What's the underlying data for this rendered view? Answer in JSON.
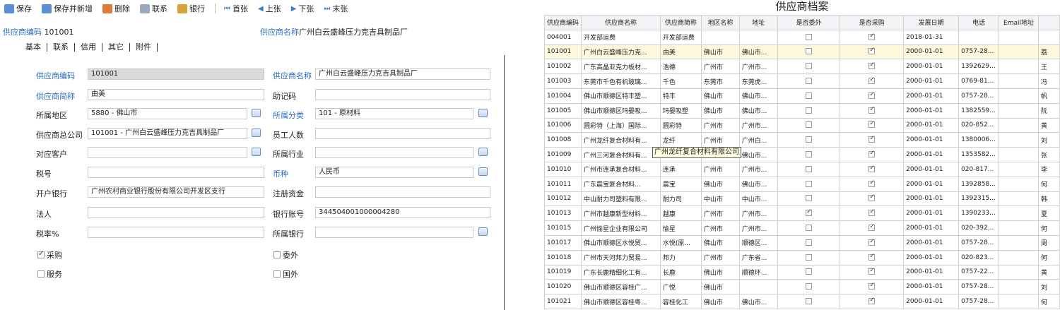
{
  "toolbar": {
    "save": "保存",
    "save_new": "保存并新增",
    "delete": "删除",
    "contact": "联系",
    "bank": "银行",
    "first": "首张",
    "prev": "上张",
    "next": "下张",
    "last": "末张"
  },
  "header": {
    "code_label": "供应商编码",
    "code_value": "101001",
    "name_label": "供应商名称",
    "name_value": "广州白云盛峰压力克吉具制品厂"
  },
  "tabs": [
    "基本",
    "联系",
    "信用",
    "其它",
    "附件"
  ],
  "form": {
    "code_label": "供应商编码",
    "code_value": "101001",
    "name_label": "供应商名称",
    "name_value": "广州白云盛峰压力克吉具制品厂",
    "abbr_label": "供应商简称",
    "abbr_value": "由美",
    "mnemonic_label": "助记码",
    "mnemonic_value": "",
    "region_label": "所属地区",
    "region_value": "5880 - 佛山市",
    "category_label": "所属分类",
    "category_value": "101 - 原材料",
    "hq_label": "供应商总公司",
    "hq_value": "101001 - 广州白云盛峰压力克吉具制品厂",
    "staff_label": "员工人数",
    "staff_value": "",
    "customer_label": "对应客户",
    "customer_value": "",
    "industry_label": "所属行业",
    "industry_value": "",
    "tax_label": "税号",
    "tax_value": "",
    "currency_label": "币种",
    "currency_value": "人民币",
    "bank_label": "开户银行",
    "bank_value": "广州农村商业银行股份有限公司开发区支行",
    "capital_label": "注册资金",
    "capital_value": "",
    "legal_label": "法人",
    "legal_value": "",
    "account_label": "银行账号",
    "account_value": "344504001000004280",
    "rate_label": "税率%",
    "rate_value": "",
    "bank2_label": "所属银行",
    "bank2_value": "",
    "purchase_label": "采购",
    "outsource_label": "委外",
    "service_label": "服务",
    "foreign_label": "国外"
  },
  "checks": {
    "purchase": true,
    "outsource": false,
    "service": false,
    "foreign": false
  },
  "list": {
    "title": "供应商档案",
    "columns": [
      "供应商编码",
      "供应商名称",
      "供应商简称",
      "地区名称",
      "地址",
      "是否委外",
      "是否采购",
      "发展日期",
      "电话",
      "Email地址",
      ""
    ],
    "rows": [
      {
        "code": "004001",
        "name": "开发部运费",
        "abbr": "开发部运费",
        "region": "",
        "addr": "",
        "out": false,
        "buy": true,
        "date": "2018-01-31",
        "tel": "",
        "email": "",
        "extra": ""
      },
      {
        "code": "101001",
        "name": "广州白云盛峰压力克...",
        "abbr": "由美",
        "region": "佛山市",
        "addr": "佛山市...",
        "out": false,
        "buy": true,
        "date": "2000-01-01",
        "tel": "0757-28...",
        "email": "",
        "extra": "荔"
      },
      {
        "code": "101002",
        "name": "广东高晶亚克力板材...",
        "abbr": "浩德",
        "region": "广州市",
        "addr": "广州市...",
        "out": false,
        "buy": true,
        "date": "2000-01-01",
        "tel": "1392629...",
        "email": "",
        "extra": "王"
      },
      {
        "code": "101003",
        "name": "东莞市千色有机玻璃...",
        "abbr": "千色",
        "region": "东莞市",
        "addr": "东莞虎...",
        "out": false,
        "buy": true,
        "date": "2000-01-01",
        "tel": "0769-81...",
        "email": "",
        "extra": "冯"
      },
      {
        "code": "101004",
        "name": "佛山市顺德区特丰塑...",
        "abbr": "特丰",
        "region": "佛山市",
        "addr": "佛山市...",
        "out": false,
        "buy": true,
        "date": "2000-01-01",
        "tel": "0757-28...",
        "email": "",
        "extra": "帆"
      },
      {
        "code": "101005",
        "name": "佛山市顺德区玛晏吸...",
        "abbr": "玛晏吸塑",
        "region": "佛山市",
        "addr": "佛山市...",
        "out": false,
        "buy": true,
        "date": "2000-01-01",
        "tel": "1382559...",
        "email": "",
        "extra": "阮"
      },
      {
        "code": "101006",
        "name": "圆彩特（上海）国际...",
        "abbr": "圆彩特",
        "region": "广州市",
        "addr": "广州市...",
        "out": false,
        "buy": true,
        "date": "2000-01-01",
        "tel": "020-852...",
        "email": "",
        "extra": "黄"
      },
      {
        "code": "101008",
        "name": "广州龙纤复合材料有...",
        "abbr": "龙纤",
        "region": "广州市",
        "addr": "广州白...",
        "out": false,
        "buy": true,
        "date": "2000-01-01",
        "tel": "1380006...",
        "email": "",
        "extra": "刘"
      },
      {
        "code": "101009",
        "name": "广州三河复合材料有...",
        "abbr": "",
        "region": "",
        "addr": "佛山市...",
        "out": false,
        "buy": true,
        "date": "2000-01-01",
        "tel": "1353582...",
        "email": "",
        "extra": "张"
      },
      {
        "code": "101010",
        "name": "广州市连承复合材料...",
        "abbr": "连承",
        "region": "广州市",
        "addr": "广州市...",
        "out": false,
        "buy": true,
        "date": "2000-01-01",
        "tel": "020-817...",
        "email": "",
        "extra": "李"
      },
      {
        "code": "101011",
        "name": "广东晨宝复合材料...",
        "abbr": "晨宝",
        "region": "佛山市",
        "addr": "佛山市...",
        "out": false,
        "buy": true,
        "date": "2000-01-01",
        "tel": "1392858...",
        "email": "",
        "extra": "何"
      },
      {
        "code": "101012",
        "name": "中山耐力司塑料有限...",
        "abbr": "耐力司",
        "region": "中山市",
        "addr": "中山市...",
        "out": false,
        "buy": true,
        "date": "2000-01-01",
        "tel": "1392315...",
        "email": "",
        "extra": "韩"
      },
      {
        "code": "101013",
        "name": "广州市越康新型材料...",
        "abbr": "越康",
        "region": "广州市",
        "addr": "广州市...",
        "out": true,
        "buy": true,
        "date": "2000-01-01",
        "tel": "1390233...",
        "email": "",
        "extra": "夏"
      },
      {
        "code": "101015",
        "name": "广州愉星企业有限公司",
        "abbr": "愉星",
        "region": "广州市",
        "addr": "广州市...",
        "out": false,
        "buy": true,
        "date": "2000-01-01",
        "tel": "020-392...",
        "email": "",
        "extra": "何"
      },
      {
        "code": "101017",
        "name": "佛山市顺德区水悦贸...",
        "abbr": "水悦(原...",
        "region": "佛山市",
        "addr": "顺德区...",
        "out": false,
        "buy": true,
        "date": "2000-01-01",
        "tel": "0757-28...",
        "email": "",
        "extra": "周"
      },
      {
        "code": "101018",
        "name": "广州市天河邦力贸易...",
        "abbr": "邦力",
        "region": "广州市",
        "addr": "广东省...",
        "out": false,
        "buy": true,
        "date": "2000-01-01",
        "tel": "020-823...",
        "email": "",
        "extra": "何"
      },
      {
        "code": "101019",
        "name": "广东长鹿精细化工有...",
        "abbr": "长鹿",
        "region": "佛山市",
        "addr": "顺德环...",
        "out": false,
        "buy": true,
        "date": "2000-01-01",
        "tel": "0757-22...",
        "email": "",
        "extra": "黄"
      },
      {
        "code": "101020",
        "name": "佛山市顺德区容桂广...",
        "abbr": "广悦",
        "region": "佛山市",
        "addr": "",
        "out": false,
        "buy": true,
        "date": "2000-01-01",
        "tel": "0757-28...",
        "email": "",
        "extra": "刘"
      },
      {
        "code": "101021",
        "name": "佛山市顺德区容桂粤...",
        "abbr": "容桂化工",
        "region": "佛山市",
        "addr": "佛山市...",
        "out": false,
        "buy": true,
        "date": "2000-01-01",
        "tel": "0757-28...",
        "email": "",
        "extra": "何"
      }
    ]
  },
  "tooltip": "广州龙纤复合材料有限公司"
}
